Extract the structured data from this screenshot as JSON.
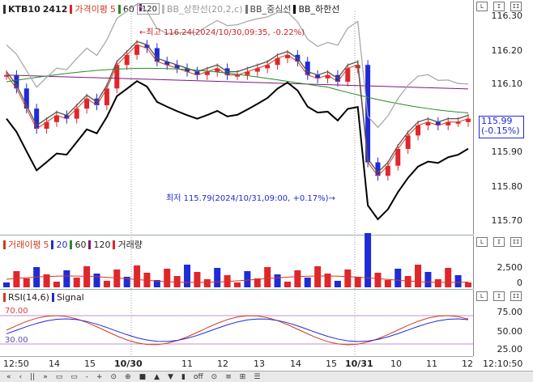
{
  "legend_main": {
    "symbol": "KTB10",
    "contract": "2412",
    "ma_label": "가격이평",
    "ma_period": "5",
    "ma2": "60",
    "ma3": "120",
    "bb_upper": "BB_상한선(20,2,c)",
    "bb_mid": "BB_중심선",
    "bb_lower": "BB_하한선"
  },
  "legend_vol": {
    "label": "거래이평",
    "p1": "5",
    "p2": "20",
    "p3": "60",
    "p4": "120",
    "vol": "거래량"
  },
  "legend_rsi": {
    "label": "RSI(14,6)",
    "signal": "Signal",
    "level_high": "70.00",
    "level_low": "30.00"
  },
  "annotations": {
    "high": "최고 116.24(2024/10/30,09:35, -0.22%)",
    "low": "최저 115.79(2024/10/31,09:00, +0.17%)"
  },
  "price_axis": [
    "116.30",
    "116.20",
    "116.10",
    "115.90",
    "115.80",
    "115.70"
  ],
  "current_price": "115.99",
  "current_change": "(-0.15%)",
  "vol_axis": [
    "2,500",
    "0"
  ],
  "rsi_axis": [
    "75.00",
    "50.00",
    "25.00"
  ],
  "x_labels": [
    "12:50",
    "14",
    "15",
    "10/30",
    "11",
    "12",
    "13",
    "14",
    "15",
    "10/31",
    "10",
    "11",
    "12"
  ],
  "time_display": "12:10:50",
  "colors": {
    "up": "#e0262b",
    "down": "#1f2bd6",
    "ma5": "#d23a1e",
    "bb": "#a9a9a9",
    "bbmid": "#555",
    "bblow": "#000",
    "ma60": "#2a8a2a",
    "ma120": "#7a1a7a"
  },
  "toolbar": [
    "«",
    "‹",
    "||",
    "»",
    "▭",
    "▭",
    "-",
    "+",
    "⊙",
    "⊕",
    "■",
    "▲",
    "▼",
    "▮",
    "off",
    "⊙",
    "≡",
    "⊞",
    "☰"
  ],
  "pane_buttons": [
    "L",
    "I",
    "II"
  ]
}
